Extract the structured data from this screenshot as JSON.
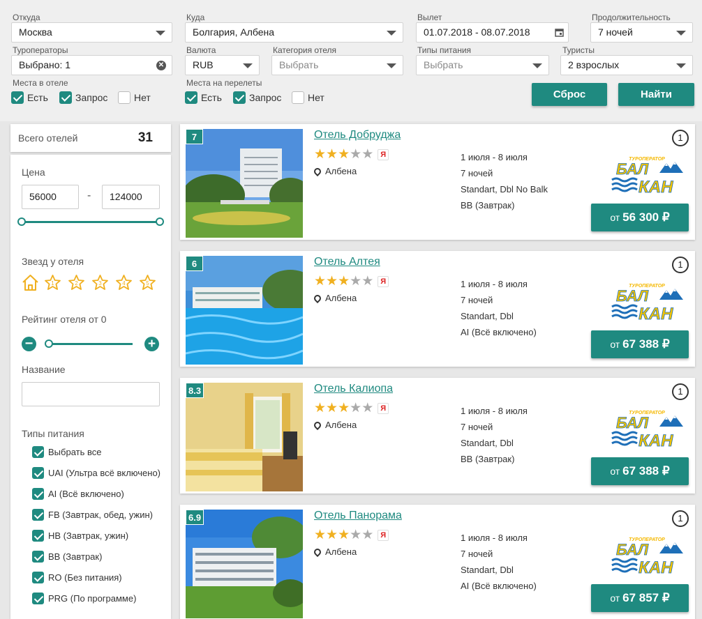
{
  "filters": {
    "from": {
      "label": "Откуда",
      "value": "Москва"
    },
    "to": {
      "label": "Куда",
      "value": "Болгария, Албена"
    },
    "departure": {
      "label": "Вылет",
      "value": "01.07.2018 - 08.07.2018"
    },
    "duration": {
      "label": "Продолжительность",
      "value": "7 ночей"
    },
    "operators": {
      "label": "Туроператоры",
      "value": "Выбрано: 1"
    },
    "currency": {
      "label": "Валюта",
      "value": "RUB"
    },
    "hotel_category": {
      "label": "Категория отеля",
      "placeholder": "Выбрать"
    },
    "meal_types": {
      "label": "Типы питания",
      "placeholder": "Выбрать"
    },
    "tourists": {
      "label": "Туристы",
      "value": "2 взрослых"
    },
    "hotel_places": {
      "label": "Места в отеле",
      "options": [
        {
          "label": "Есть",
          "checked": true
        },
        {
          "label": "Запрос",
          "checked": true
        },
        {
          "label": "Нет",
          "checked": false
        }
      ]
    },
    "flight_places": {
      "label": "Места на перелеты",
      "options": [
        {
          "label": "Есть",
          "checked": true
        },
        {
          "label": "Запрос",
          "checked": true
        },
        {
          "label": "Нет",
          "checked": false
        }
      ]
    },
    "reset_label": "Сброс",
    "search_label": "Найти"
  },
  "sidebar": {
    "total_label": "Всего отелей",
    "total_count": "31",
    "price_label": "Цена",
    "price_min": "56000",
    "price_sep": "-",
    "price_max": "124000",
    "stars_label": "Звезд у отеля",
    "star_options": [
      "1",
      "2",
      "3",
      "4",
      "5"
    ],
    "rating_label": "Рейтинг отеля от 0",
    "name_label": "Название",
    "meal_label": "Типы питания",
    "meal_options": [
      {
        "label": "Выбрать все",
        "checked": true
      },
      {
        "label": "UAI (Ультра всё включено)",
        "checked": true
      },
      {
        "label": "AI (Всё включено)",
        "checked": true
      },
      {
        "label": "FB (Завтрак, обед, ужин)",
        "checked": true
      },
      {
        "label": "HB (Завтрак, ужин)",
        "checked": true
      },
      {
        "label": "BB (Завтрак)",
        "checked": true
      },
      {
        "label": "RO (Без питания)",
        "checked": true
      },
      {
        "label": "PRG (По программе)",
        "checked": true
      }
    ]
  },
  "hotels": [
    {
      "rating": "7",
      "name": "Отель Добруджа",
      "stars": 3,
      "location": "Албена",
      "dates": "1 июля - 8 июля",
      "nights": "7 ночей",
      "room": "Standart, Dbl No Balk",
      "meal": "BB (Завтрак)",
      "offers": "1",
      "price_prefix": "от",
      "price": "56 300 ₽",
      "photo": "building"
    },
    {
      "rating": "6",
      "name": "Отель Алтея",
      "stars": 3,
      "location": "Албена",
      "dates": "1 июля - 8 июля",
      "nights": "7 ночей",
      "room": "Standart, Dbl",
      "meal": "AI (Всё включено)",
      "offers": "1",
      "price_prefix": "от",
      "price": "67 388 ₽",
      "photo": "pool"
    },
    {
      "rating": "8.3",
      "name": "Отель Калиопа",
      "stars": 3,
      "location": "Албена",
      "dates": "1 июля - 8 июля",
      "nights": "7 ночей",
      "room": "Standart, Dbl",
      "meal": "BB (Завтрак)",
      "offers": "1",
      "price_prefix": "от",
      "price": "67 388 ₽",
      "photo": "room"
    },
    {
      "rating": "6.9",
      "name": "Отель Панорама",
      "stars": 3,
      "location": "Албена",
      "dates": "1 июля - 8 июля",
      "nights": "7 ночей",
      "room": "Standart, Dbl",
      "meal": "AI (Всё включено)",
      "offers": "1",
      "price_prefix": "от",
      "price": "67 857 ₽",
      "photo": "lowrise"
    }
  ],
  "operator_logo": {
    "top": "ТУРОПЕРАТОР",
    "line1": "БАЛ",
    "line2": "КАН"
  },
  "colors": {
    "accent": "#1f8a80",
    "star": "#f0b020",
    "logo_yellow": "#f5c400",
    "logo_blue": "#1e6fb8"
  }
}
